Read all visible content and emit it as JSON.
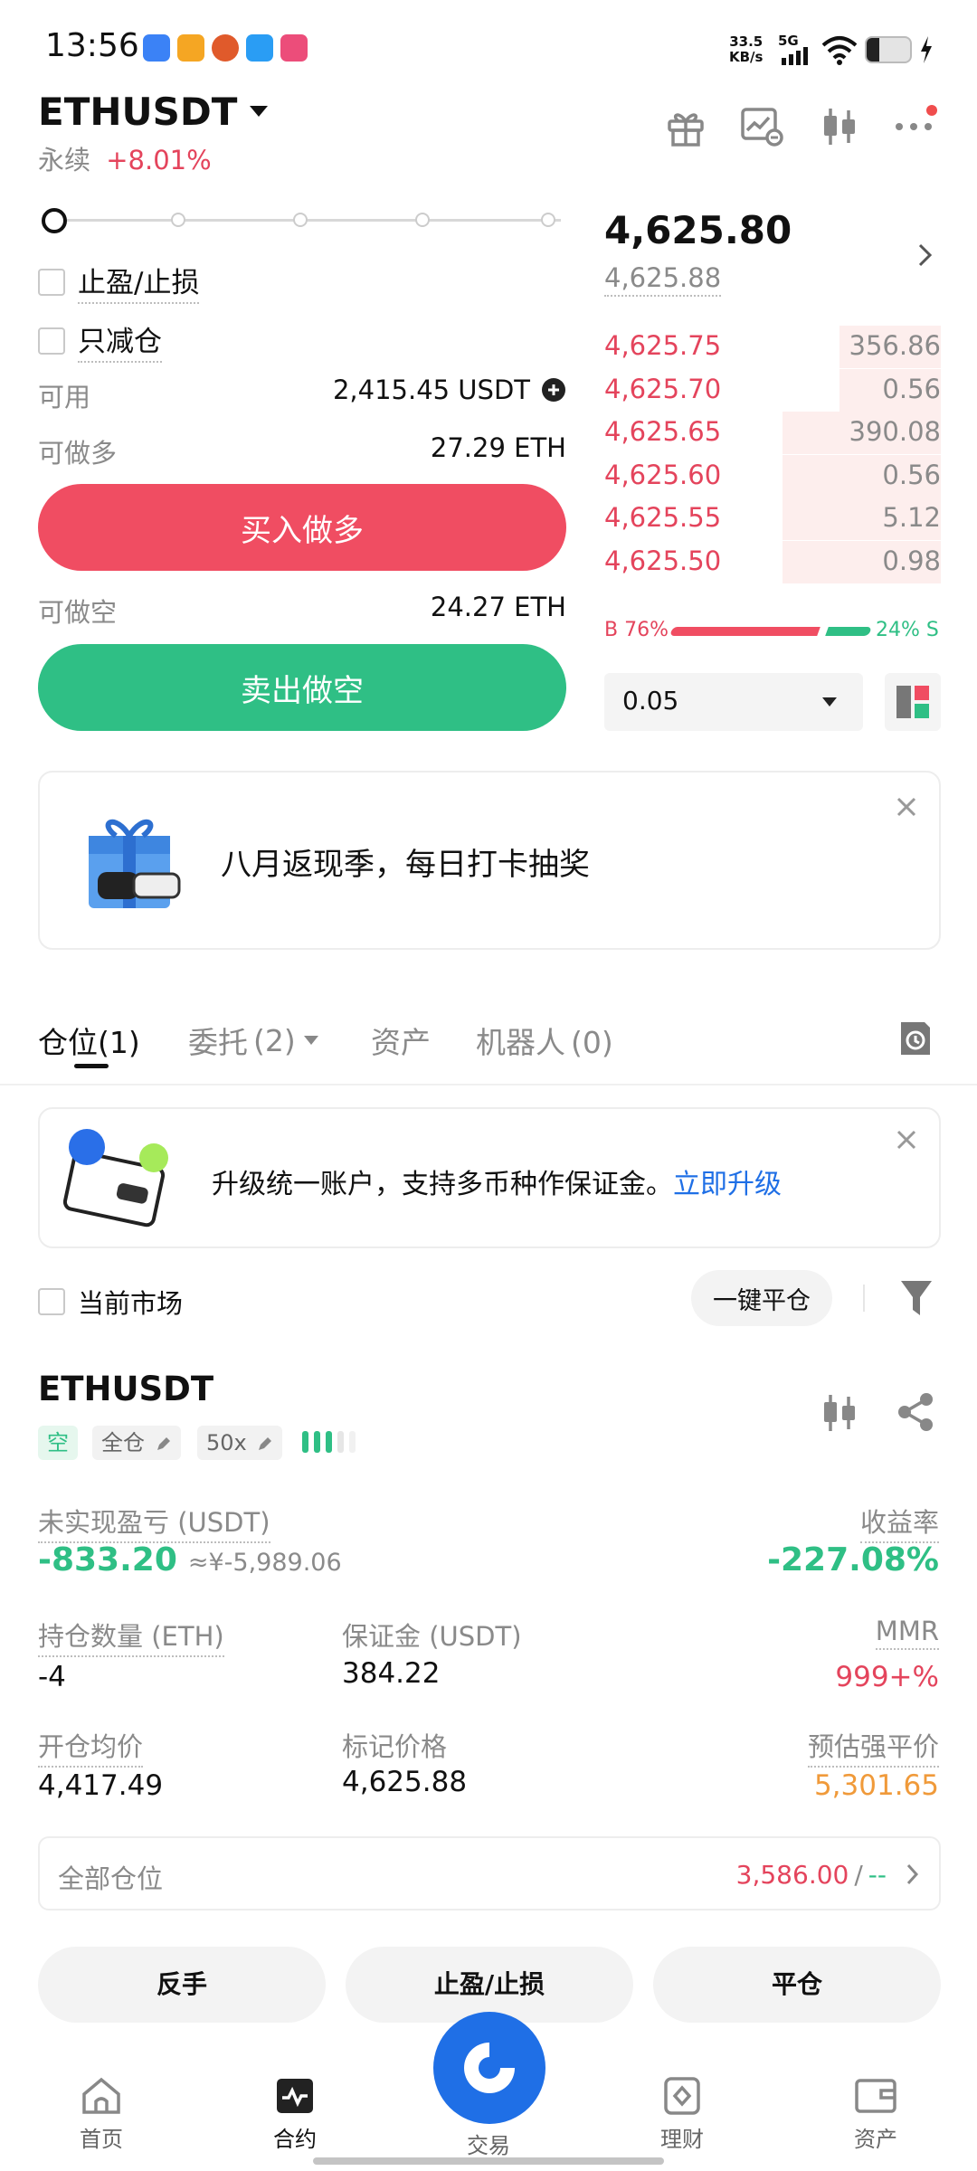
{
  "status_bar": {
    "time": "13:56",
    "speed_value": "33.5",
    "speed_unit": "KB/s",
    "network": "5G"
  },
  "header": {
    "symbol": "ETHUSDT",
    "subtitle_type": "永续",
    "change": "+8.01%"
  },
  "order_form": {
    "tp_sl_label": "止盈/止损",
    "reduce_only_label": "只减仓",
    "available_label": "可用",
    "available_value": "2,415.45 USDT",
    "max_long_label": "可做多",
    "max_long_value": "27.29 ETH",
    "buy_button": "买入做多",
    "max_short_label": "可做空",
    "max_short_value": "24.27 ETH",
    "sell_button": "卖出做空",
    "slider_level": 0
  },
  "orderbook": {
    "last_price": "4,625.80",
    "mark_price": "4,625.88",
    "asks": [
      {
        "price": "4,625.75",
        "qty": "356.86",
        "depth": 0.3
      },
      {
        "price": "4,625.70",
        "qty": "0.56",
        "depth": 0.3
      },
      {
        "price": "4,625.65",
        "qty": "390.08",
        "depth": 0.47
      },
      {
        "price": "4,625.60",
        "qty": "0.56",
        "depth": 0.47
      },
      {
        "price": "4,625.55",
        "qty": "5.12",
        "depth": 0.47
      },
      {
        "price": "4,625.50",
        "qty": "0.98",
        "depth": 0.47
      }
    ],
    "buy_ratio_label": "B 76%",
    "sell_ratio_label": "24% S",
    "buy_ratio": 0.76,
    "precision": "0.05"
  },
  "banner": {
    "text": "八月返现季，每日打卡抽奖"
  },
  "tabs": [
    {
      "label": "仓位",
      "count": "(1)"
    },
    {
      "label": "委托",
      "count": "(2)"
    },
    {
      "label": "资产",
      "count": ""
    },
    {
      "label": "机器人",
      "count": "(0)"
    }
  ],
  "upgrade": {
    "text": "升级统一账户，支持多币种作保证金。",
    "link": "立即升级"
  },
  "filters": {
    "current_market": "当前市场",
    "close_all": "一键平仓"
  },
  "position": {
    "symbol": "ETHUSDT",
    "side_tag": "空",
    "margin_mode_tag": "全仓",
    "leverage_tag": "50x",
    "pnl_label": "未实现盈亏 (USDT)",
    "pnl_value": "-833.20",
    "pnl_cny": "≈¥-5,989.06",
    "roe_label": "收益率",
    "roe_value": "-227.08%",
    "size_label": "持仓数量 (ETH)",
    "size_value": "-4",
    "margin_label": "保证金 (USDT)",
    "margin_value": "384.22",
    "mmr_label": "MMR",
    "mmr_value": "999+%",
    "entry_label": "开仓均价",
    "entry_value": "4,417.49",
    "mark_label": "标记价格",
    "mark_value": "4,625.88",
    "liq_label": "预估强平价",
    "liq_value": "5,301.65",
    "all_positions_label": "全部仓位",
    "all_positions_value": "3,586.00",
    "all_positions_sep": "/",
    "all_positions_extra": "--",
    "reverse_btn": "反手",
    "tpsl_btn": "止盈/止损",
    "close_btn": "平仓"
  },
  "bottom_nav": {
    "home": "首页",
    "futures": "合约",
    "trade": "交易",
    "earn": "理财",
    "assets": "资产"
  },
  "colors": {
    "buy": "#f04d62",
    "sell": "#2fbf85",
    "accent_blue": "#1f6fe6"
  }
}
